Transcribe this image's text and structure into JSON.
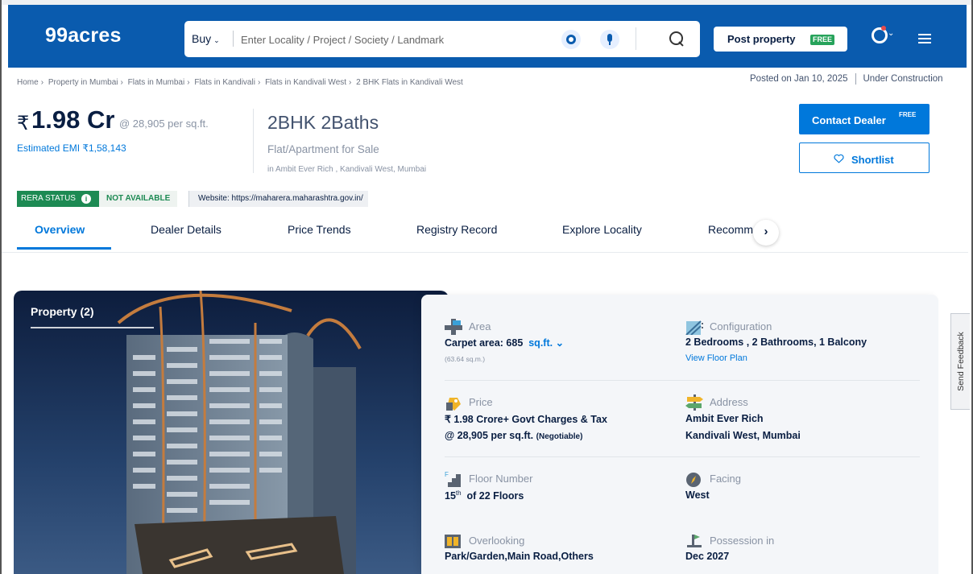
{
  "header": {
    "logo": "99acres",
    "search": {
      "buy_label": "Buy",
      "placeholder": "Enter Locality / Project / Society / Landmark"
    },
    "post_property": {
      "label": "Post property",
      "badge": "FREE"
    }
  },
  "breadcrumb": [
    "Home",
    "Property in Mumbai",
    "Flats in Mumbai",
    "Flats in Kandivali",
    "Flats in Kandivali West",
    "2 BHK Flats in Kandivali West"
  ],
  "meta": {
    "posted_on": "Posted on Jan 10, 2025",
    "status": "Under Construction"
  },
  "price": {
    "symbol": "₹",
    "amount": "1.98 Cr",
    "rate": "@ 28,905 per sq.ft.",
    "emi": "Estimated EMI ₹1,58,143"
  },
  "listing": {
    "bhk": "2BHK 2Baths",
    "type": "Flat/Apartment for Sale",
    "project": "in Ambit Ever Rich , Kandivali West, Mumbai"
  },
  "actions": {
    "contact": "Contact Dealer",
    "contact_badge": "FREE",
    "shortlist": "Shortlist"
  },
  "rera": {
    "label": "RERA STATUS",
    "status": "NOT AVAILABLE",
    "website": "Website: https://maharera.maharashtra.gov.in/"
  },
  "tabs": [
    "Overview",
    "Dealer Details",
    "Price Trends",
    "Registry Record",
    "Explore Locality",
    "Recommendations"
  ],
  "gallery": {
    "label": "Property (2)"
  },
  "details": {
    "area": {
      "title": "Area",
      "value": "Carpet area: 685",
      "unit": "sq.ft.",
      "sub": "(63.64 sq.m.)"
    },
    "configuration": {
      "title": "Configuration",
      "value": "2 Bedrooms , 2 Bathrooms, 1 Balcony",
      "link": "View Floor Plan"
    },
    "price": {
      "title": "Price",
      "line1": "₹ 1.98 Crore+ Govt Charges & Tax",
      "line2": "@ 28,905 per sq.ft.",
      "negotiable": "(Negotiable)"
    },
    "address": {
      "title": "Address",
      "line1": "Ambit Ever Rich",
      "line2": "Kandivali West, Mumbai"
    },
    "floor": {
      "title": "Floor Number",
      "floor": "15",
      "sup": "th",
      "of": "of 22 Floors"
    },
    "facing": {
      "title": "Facing",
      "value": "West"
    },
    "overlooking": {
      "title": "Overlooking",
      "value": "Park/Garden,Main Road,Others"
    },
    "possession": {
      "title": "Possession in",
      "value": "Dec 2027"
    }
  },
  "feedback": {
    "label": "Send Feedback"
  },
  "colors": {
    "brand": "#0A5BAE",
    "accent": "#0078DB",
    "rera_green": "#1d8a53",
    "free_green": "#27a35b"
  }
}
